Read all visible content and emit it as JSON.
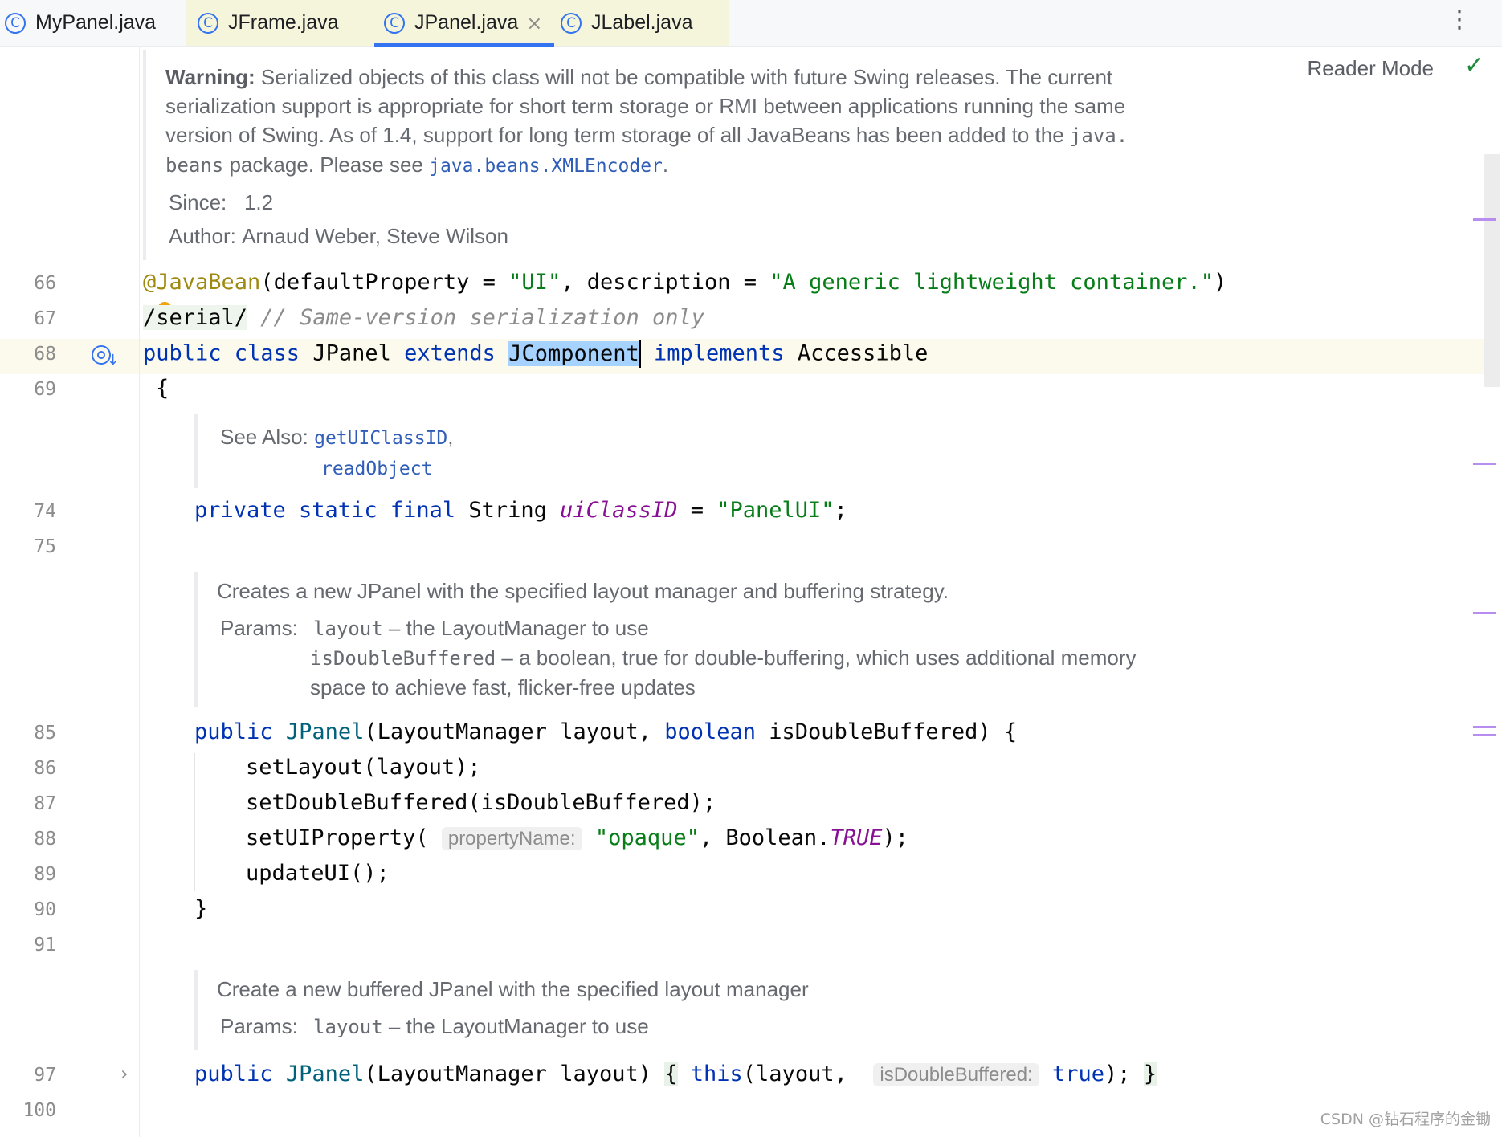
{
  "tabs": [
    {
      "label": "MyPanel.java",
      "icon": "class-icon"
    },
    {
      "label": "JFrame.java",
      "icon": "class-icon"
    },
    {
      "label": "JPanel.java",
      "icon": "class-icon",
      "active": true
    },
    {
      "label": "JLabel.java",
      "icon": "class-icon"
    }
  ],
  "toolbar": {
    "reader_mode": "Reader Mode",
    "more": "⋮",
    "close": "×",
    "check": "✓"
  },
  "doc1": {
    "warning_label": "Warning:",
    "line1": " Serialized objects of this class will not be compatible with future Swing releases. The current",
    "line2": "serialization support is appropriate for short term storage or RMI between applications running the same",
    "line3_a": "version of Swing. As of 1.4, support for long term storage of all JavaBeans has been added to the ",
    "line3_mono": "java.",
    "line4_mono": "beans",
    "line4_a": " package. Please see ",
    "line4_link": "java.beans.XMLEncoder",
    "line4_end": ".",
    "since_label": "Since:",
    "since_value": "1.2",
    "author_label": "Author:",
    "author_value": "Arnaud Weber, Steve Wilson"
  },
  "line_numbers": {
    "l66": "66",
    "l67": "67",
    "l68": "68",
    "l69": "69",
    "l74": "74",
    "l75": "75",
    "l85": "85",
    "l86": "86",
    "l87": "87",
    "l88": "88",
    "l89": "89",
    "l90": "90",
    "l91": "91",
    "l97": "97",
    "l100": "100"
  },
  "code": {
    "l66_ann": "@JavaBean",
    "l66_a": "(defaultProperty = ",
    "l66_s1": "\"UI\"",
    "l66_b": ", description = ",
    "l66_s2": "\"A generic lightweight container.\"",
    "l66_c": ")",
    "l67_a": "/serial/",
    "l67_cmt": " // Same-version serialization only",
    "l68_kw1": "public class",
    "l68_a": " JPanel ",
    "l68_kw2": "extends",
    "l68_sel": "JComponent",
    "l68_kw3": "implements",
    "l68_b": " Accessible",
    "l69": "{",
    "l74_kw": "private static final",
    "l74_a": " String ",
    "l74_fld": "uiClassID",
    "l74_b": " = ",
    "l74_s": "\"PanelUI\"",
    "l74_c": ";",
    "l85_kw": "public",
    "l85_m": "JPanel",
    "l85_a": "(LayoutManager layout, ",
    "l85_kw2": "boolean",
    "l85_b": " isDoubleBuffered) {",
    "l86": "setLayout(layout);",
    "l87": "setDoubleBuffered(isDoubleBuffered);",
    "l88_a": "setUIProperty(",
    "l88_hint": "propertyName:",
    "l88_s": "\"opaque\"",
    "l88_b": ", Boolean.",
    "l88_fld": "TRUE",
    "l88_c": ");",
    "l89": "updateUI();",
    "l90": "}",
    "l97_kw": "public",
    "l97_m": "JPanel",
    "l97_a": "(LayoutManager layout) ",
    "l97_ob": "{",
    "l97_kw2": "this",
    "l97_b": "(layout, ",
    "l97_hint": "isDoubleBuffered:",
    "l97_kw3": "true",
    "l97_c": ");",
    "l97_cb": "}"
  },
  "doc2": {
    "see_also_label": "See Also:",
    "link1": "getUIClassID",
    "comma": ",",
    "link2": "readObject"
  },
  "doc3": {
    "desc": "Creates a new JPanel with the specified layout manager and buffering strategy.",
    "params_label": "Params:",
    "p1_name": "layout",
    "p1_desc": " – the LayoutManager to use",
    "p2_name": "isDoubleBuffered",
    "p2_desc": " – a boolean, true for double-buffering, which uses additional memory",
    "p2_desc2": "space to achieve fast, flicker-free updates"
  },
  "doc4": {
    "desc": "Create a new buffered JPanel with the specified layout manager",
    "params_label": "Params:",
    "p1_name": "layout",
    "p1_desc": " – the LayoutManager to use"
  },
  "watermark": "CSDN @钻石程序的金锄",
  "colors": {
    "accent": "#3574f0",
    "keyword": "#0033b3",
    "string": "#067d17",
    "annotation": "#9e880d",
    "comment": "#8c8c8c",
    "field": "#871094",
    "selection": "#a6d2ff"
  }
}
